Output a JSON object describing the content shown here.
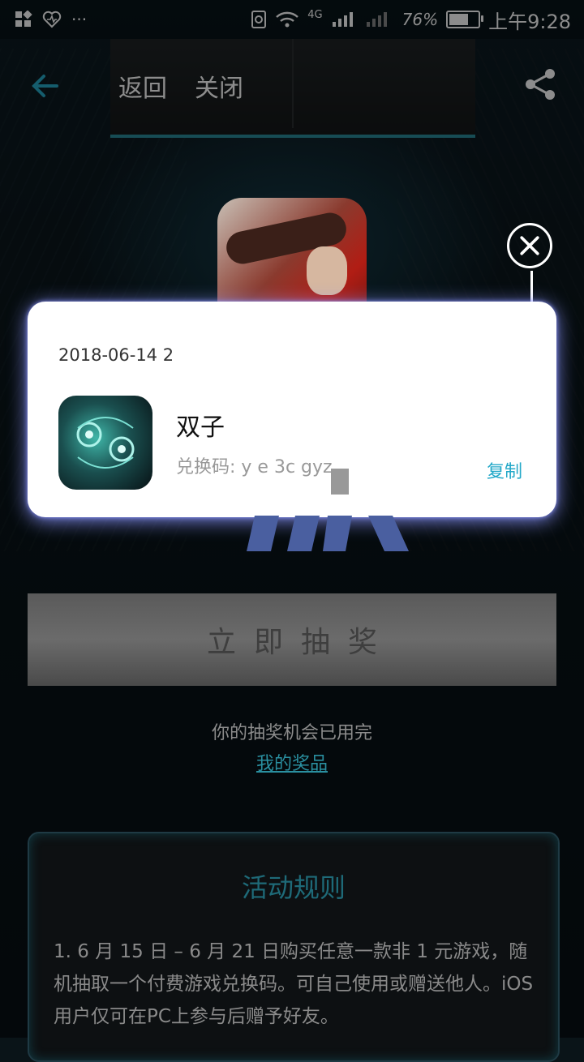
{
  "status_bar": {
    "network": "4G",
    "battery_percent": "76%",
    "battery_level": 0.76,
    "time": "上午9:28"
  },
  "nav": {
    "back_label": "返回",
    "close_label": "关闭"
  },
  "prize_card": {
    "date": "2018-06-14 2",
    "game_name": "双子",
    "code_label": "兑换码: y e 3c gyz",
    "copy_label": "复制"
  },
  "draw_button": {
    "label": "立即抽奖"
  },
  "chance_text": "你的抽奖机会已用完",
  "my_prize_link": "我的奖品",
  "rules": {
    "title": "活动规则",
    "body": "1. 6 月 15 日 – 6 月 21 日购买任意一款非 1 元游戏，随机抽取一个付费游戏兑换码。可自己使用或赠送他人。iOS 用户仅可在PC上参与后赠予好友。"
  },
  "colors": {
    "accent": "#23a8c8",
    "card_glow": "#8c96ff",
    "rules_title": "#1e6a78"
  }
}
